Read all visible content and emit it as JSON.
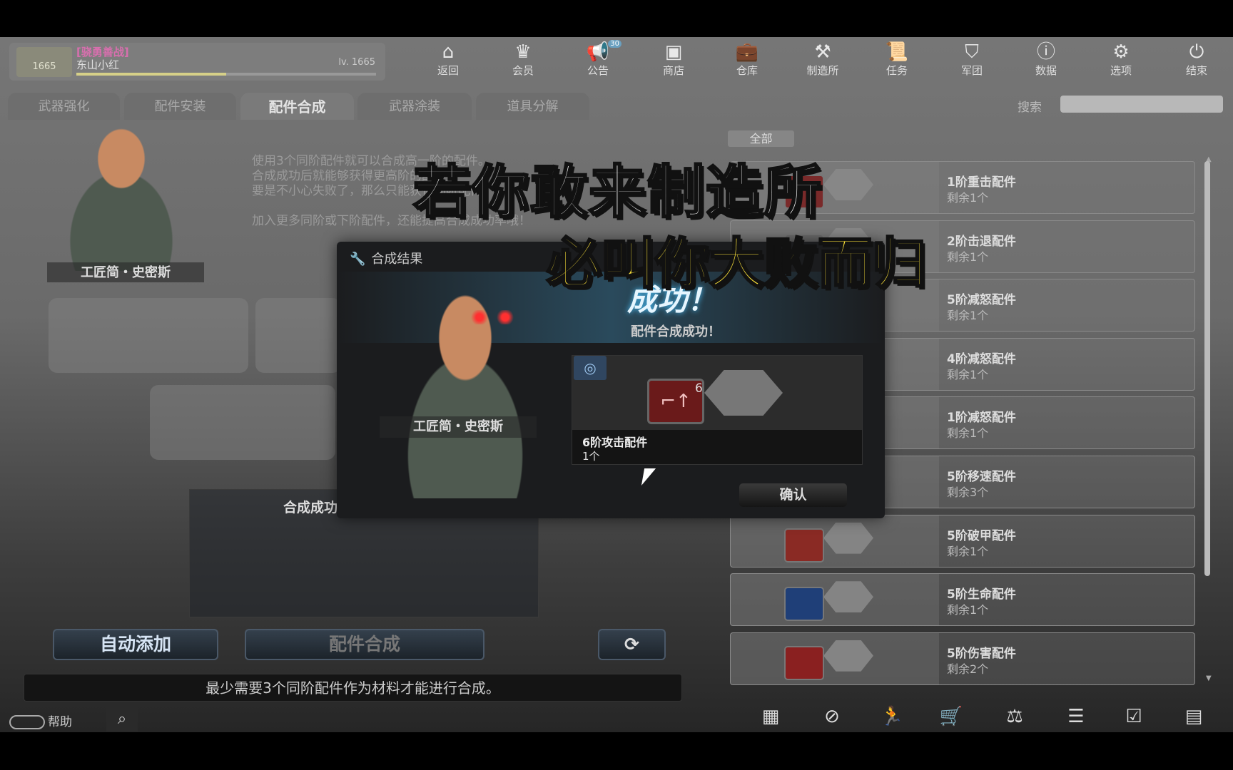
{
  "player": {
    "clan": "[骁勇善战]",
    "name": "东山小红",
    "level_badge": "1665",
    "level_text": "lv. 1665",
    "xp_progress": 0.5
  },
  "nav": [
    {
      "label": "返回",
      "icon": "home-icon",
      "glyph": "⌂"
    },
    {
      "label": "会员",
      "icon": "crown-icon",
      "glyph": "♛"
    },
    {
      "label": "公告",
      "icon": "megaphone-icon",
      "glyph": "📢",
      "count": "30"
    },
    {
      "label": "商店",
      "icon": "shop-icon",
      "glyph": "▣"
    },
    {
      "label": "仓库",
      "icon": "briefcase-icon",
      "glyph": "💼"
    },
    {
      "label": "制造所",
      "icon": "hammer-icon",
      "glyph": "⚒"
    },
    {
      "label": "任务",
      "icon": "scroll-icon",
      "glyph": "📜"
    },
    {
      "label": "军团",
      "icon": "shield-icon",
      "glyph": "⛉"
    },
    {
      "label": "数据",
      "icon": "info-icon",
      "glyph": "ⓘ"
    },
    {
      "label": "选项",
      "icon": "gear-icon",
      "glyph": "⚙"
    },
    {
      "label": "结束",
      "icon": "power-icon",
      "glyph": "⏻"
    }
  ],
  "tabs": [
    "武器强化",
    "配件安装",
    "配件合成",
    "武器涂装",
    "道具分解"
  ],
  "active_tab": "配件合成",
  "search": {
    "label": "搜索",
    "value": ""
  },
  "filter_tab": "全部",
  "description": [
    "使用3个同阶配件就可以合成高一阶的配件。",
    "合成成功后就能够获得更高阶的配件，",
    "要是不小心失败了，那么只能获得同阶配件。",
    "",
    "加入更多同阶或下阶配件，还能提高合成成功率哦！"
  ],
  "npc_name": "工匠简・史密斯",
  "success_rate": "合成成功率: 0.00%",
  "buttons": {
    "auto_add": "自动添加",
    "combine": "配件合成",
    "refresh_icon": "refresh-icon"
  },
  "hint": "最少需要3个同阶配件作为材料才能进行合成。",
  "footer": {
    "help": "帮助"
  },
  "footer_icons": [
    "calendar-icon",
    "compass-icon",
    "runner-icon",
    "cart-icon",
    "scale-icon",
    "list-check-icon",
    "checkbox-calendar-icon",
    "film-icon"
  ],
  "list": [
    {
      "name": "1阶重击配件",
      "remain": "剩余1个",
      "color": "#7a2a2a",
      "tier": "1"
    },
    {
      "name": "2阶击退配件",
      "remain": "剩余1个",
      "color": "#6a6a6a",
      "tier": "2"
    },
    {
      "name": "5阶减怒配件",
      "remain": "剩余1个",
      "color": "#6a6a6a",
      "tier": "5"
    },
    {
      "name": "4阶减怒配件",
      "remain": "剩余1个",
      "color": "#6a6a6a",
      "tier": "4"
    },
    {
      "name": "1阶减怒配件",
      "remain": "剩余1个",
      "color": "#6a6a6a",
      "tier": "1"
    },
    {
      "name": "5阶移速配件",
      "remain": "剩余3个",
      "color": "#6a6a6a",
      "tier": "5"
    },
    {
      "name": "5阶破甲配件",
      "remain": "剩余1个",
      "color": "#8a2a24",
      "tier": "5"
    },
    {
      "name": "5阶生命配件",
      "remain": "剩余1个",
      "color": "#1f3f78",
      "tier": "5"
    },
    {
      "name": "5阶伤害配件",
      "remain": "剩余2个",
      "color": "#8a2020",
      "tier": "5"
    }
  ],
  "dialog": {
    "title": "合成结果",
    "headline": "成功！",
    "message": "配件合成成功！",
    "npc_name": "工匠简・史密斯",
    "result": {
      "name": "6阶攻击配件",
      "count": "1个",
      "tier": "6"
    },
    "confirm": "确认"
  },
  "caption": {
    "line1": "若你敢来制造所",
    "line2": "必叫你大败而归"
  }
}
